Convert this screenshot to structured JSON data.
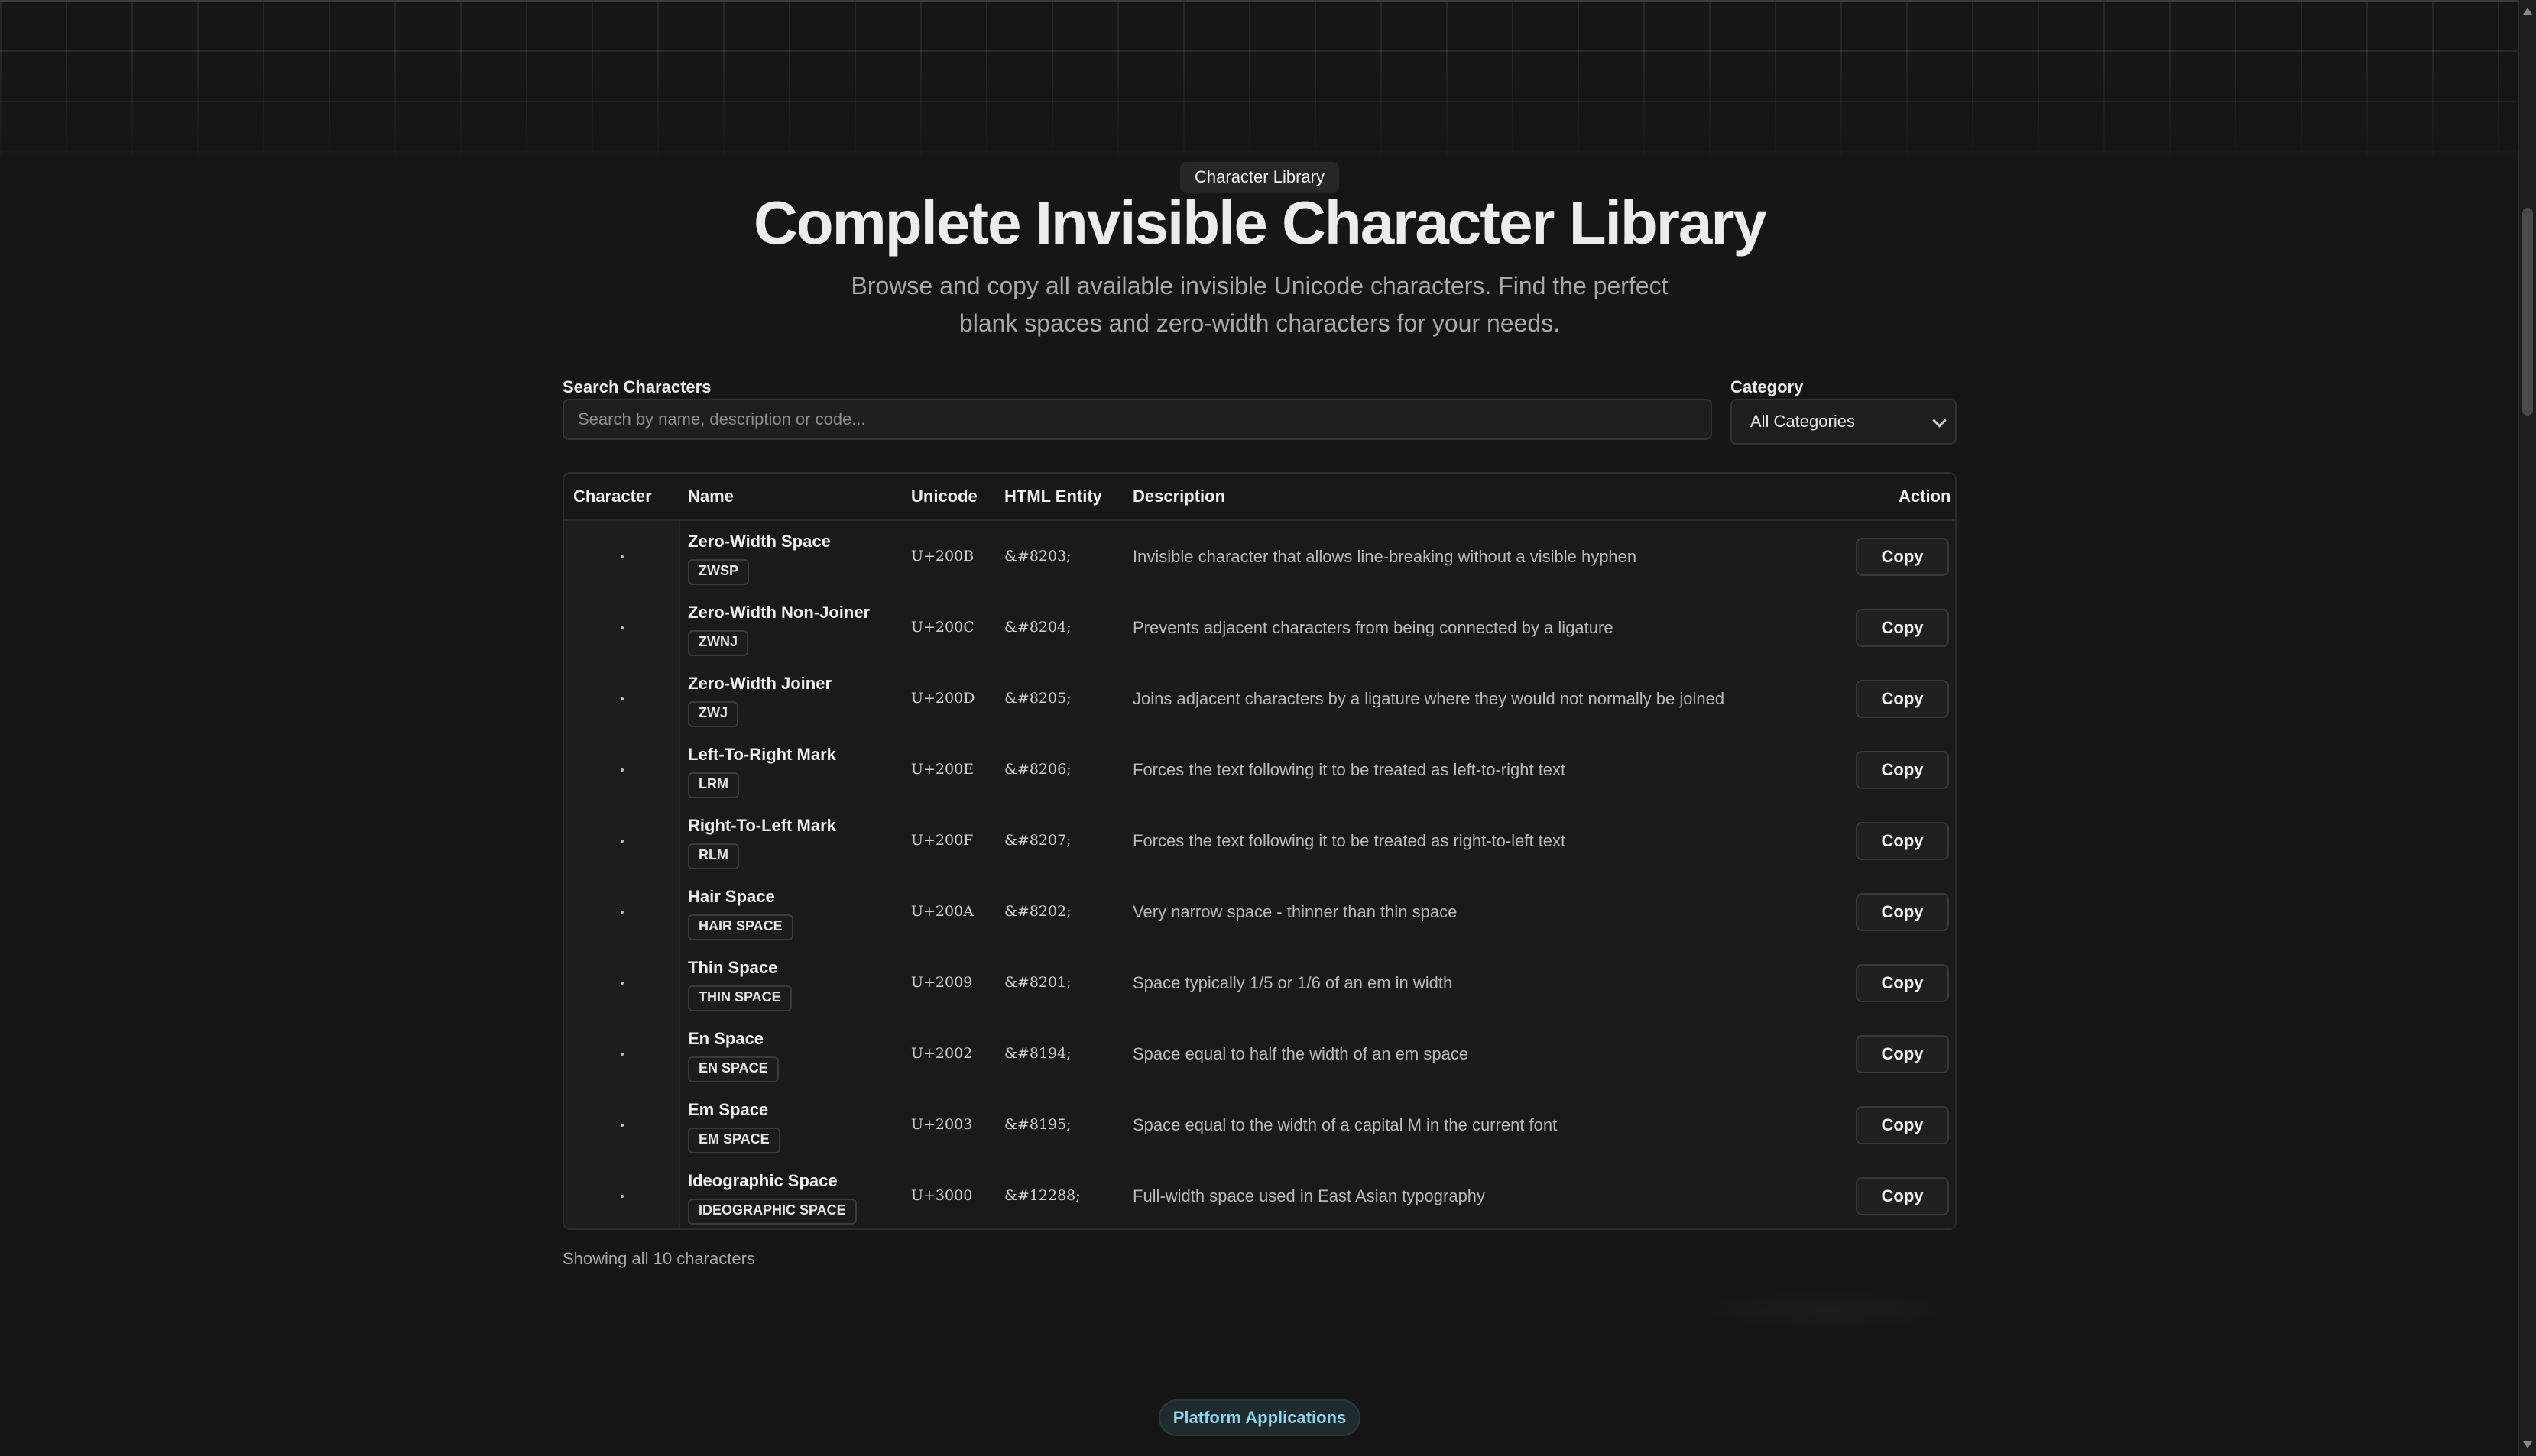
{
  "hero": {
    "eyebrow": "Character Library",
    "title": "Complete Invisible Character Library",
    "subtitle": "Browse and copy all available invisible Unicode characters. Find the perfect blank spaces and zero-width characters for your needs."
  },
  "search": {
    "label": "Search Characters",
    "placeholder": "Search by name, description or code...",
    "value": ""
  },
  "category": {
    "label": "Category",
    "selected": "All Categories"
  },
  "table": {
    "headers": {
      "character": "Character",
      "name": "Name",
      "unicode": "Unicode",
      "entity": "HTML Entity",
      "description": "Description",
      "action": "Action"
    },
    "rows": [
      {
        "name": "Zero-Width Space",
        "abbr": "ZWSP",
        "unicode": "U+200B",
        "entity": "&#8203;",
        "description": "Invisible character that allows line-breaking without a visible hyphen",
        "action": "Copy"
      },
      {
        "name": "Zero-Width Non-Joiner",
        "abbr": "ZWNJ",
        "unicode": "U+200C",
        "entity": "&#8204;",
        "description": "Prevents adjacent characters from being connected by a ligature",
        "action": "Copy"
      },
      {
        "name": "Zero-Width Joiner",
        "abbr": "ZWJ",
        "unicode": "U+200D",
        "entity": "&#8205;",
        "description": "Joins adjacent characters by a ligature where they would not normally be joined",
        "action": "Copy"
      },
      {
        "name": "Left-To-Right Mark",
        "abbr": "LRM",
        "unicode": "U+200E",
        "entity": "&#8206;",
        "description": "Forces the text following it to be treated as left-to-right text",
        "action": "Copy"
      },
      {
        "name": "Right-To-Left Mark",
        "abbr": "RLM",
        "unicode": "U+200F",
        "entity": "&#8207;",
        "description": "Forces the text following it to be treated as right-to-left text",
        "action": "Copy"
      },
      {
        "name": "Hair Space",
        "abbr": "HAIR SPACE",
        "unicode": "U+200A",
        "entity": "&#8202;",
        "description": "Very narrow space - thinner than thin space",
        "action": "Copy"
      },
      {
        "name": "Thin Space",
        "abbr": "THIN SPACE",
        "unicode": "U+2009",
        "entity": "&#8201;",
        "description": "Space typically 1/5 or 1/6 of an em in width",
        "action": "Copy"
      },
      {
        "name": "En Space",
        "abbr": "EN SPACE",
        "unicode": "U+2002",
        "entity": "&#8194;",
        "description": "Space equal to half the width of an em space",
        "action": "Copy"
      },
      {
        "name": "Em Space",
        "abbr": "EM SPACE",
        "unicode": "U+2003",
        "entity": "&#8195;",
        "description": "Space equal to the width of a capital M in the current font",
        "action": "Copy"
      },
      {
        "name": "Ideographic Space",
        "abbr": "IDEOGRAPHIC SPACE",
        "unicode": "U+3000",
        "entity": "&#12288;",
        "description": "Full-width space used in East Asian typography",
        "action": "Copy"
      }
    ]
  },
  "footer": {
    "count": "Showing all 10 characters",
    "pill": "Platform Applications"
  },
  "colors": {
    "background": "#161616",
    "pill_text": "#8ad6ea"
  }
}
